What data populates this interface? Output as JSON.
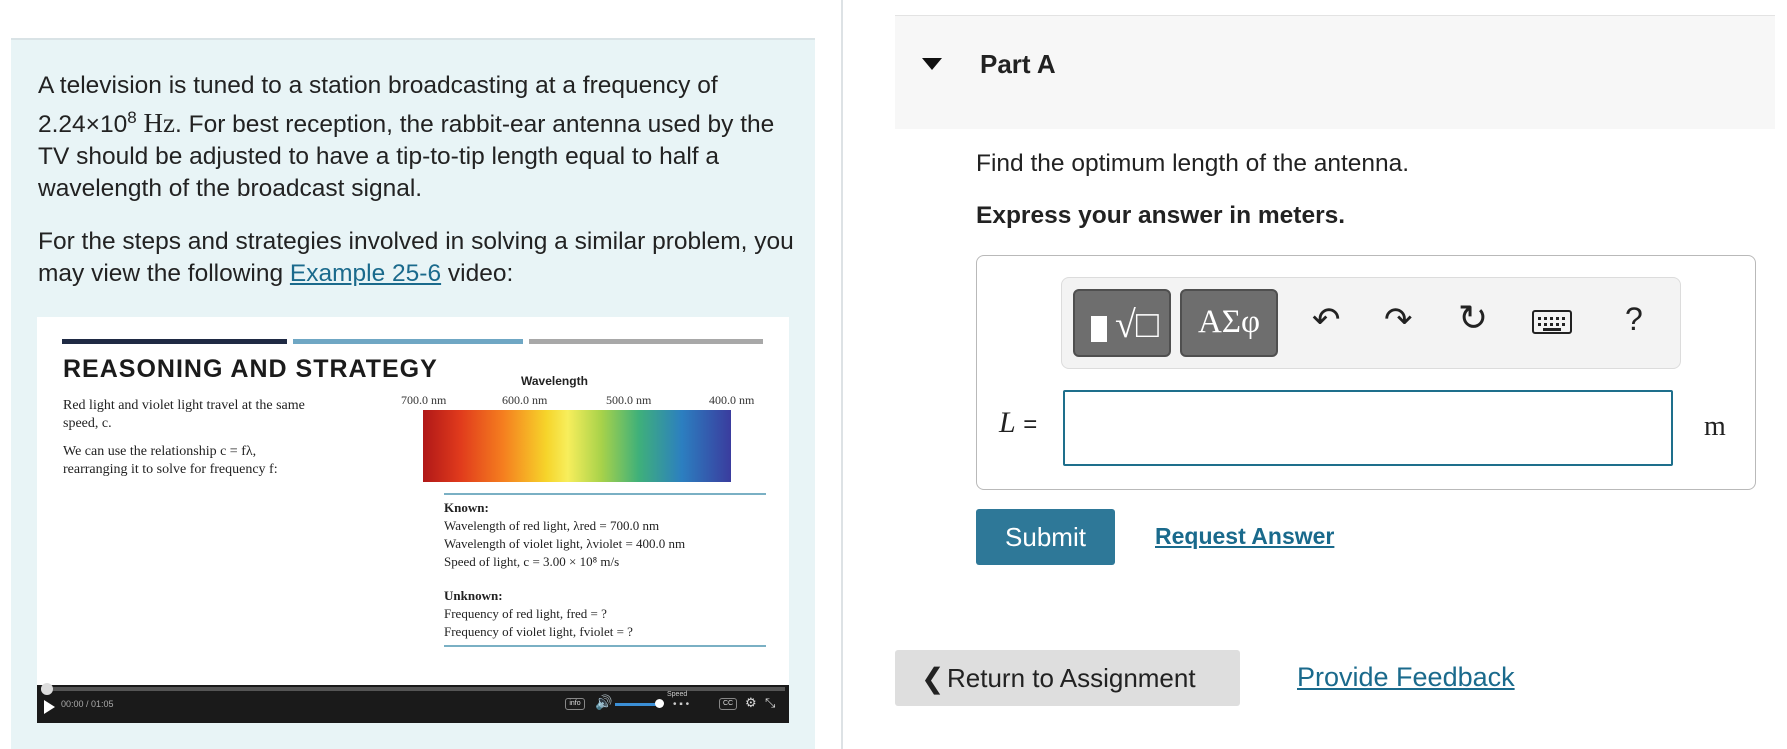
{
  "problem": {
    "p1_part1": "A television is tuned to a station broadcasting at a frequency of",
    "p1_freq_mantissa": "2.24×10",
    "p1_freq_exp": "8",
    "p1_freq_unit": "Hz",
    "p1_part2": ". For best reception, the rabbit-ear antenna used by the TV should be adjusted to have a tip-to-tip length equal to half a wavelength of the broadcast signal.",
    "p2_part1": "For the steps and strategies involved in solving a similar problem, you may view the following",
    "p2_link": "Example 25-6",
    "p2_part2": "video:"
  },
  "video": {
    "title": "REASONING AND STRATEGY",
    "bar_colors": [
      "#1f2a44",
      "#6fa7c4",
      "#a8a8a8"
    ],
    "text_1": "Red light and violet light travel at the same speed, c.",
    "text_2": "We can use the relationship c = fλ, rearranging it to solve for frequency f:",
    "wavelength_label": "Wavelength",
    "ticks": [
      "700.0 nm",
      "600.0 nm",
      "500.0 nm",
      "400.0 nm"
    ],
    "known_title": "Known:",
    "known_1": "Wavelength of red light, λred = 700.0 nm",
    "known_2": "Wavelength of violet light, λviolet = 400.0 nm",
    "known_3": "Speed of light, c = 3.00 × 10⁸ m/s",
    "unknown_title": "Unknown:",
    "unknown_1": "Frequency of red light, fred = ?",
    "unknown_2": "Frequency of violet light, fviolet = ?",
    "time": "00:00 / 01:05",
    "info_label": "info",
    "speed_label": "Speed",
    "cc_label": "CC",
    "progress": 0
  },
  "part": {
    "title": "Part A",
    "question": "Find the optimum length of the antenna.",
    "instruction": "Express your answer in meters."
  },
  "answer": {
    "symbols_label": "ΑΣφ",
    "help_label": "?",
    "var_name": "L",
    "equals": "=",
    "input_value": "",
    "unit": "m"
  },
  "actions": {
    "submit": "Submit",
    "request": "Request Answer",
    "return": "Return to Assignment",
    "feedback": "Provide Feedback"
  },
  "colors": {
    "panel_bg": "#e8f4f6",
    "accent": "#2e7898",
    "link": "#1a6a8c"
  }
}
